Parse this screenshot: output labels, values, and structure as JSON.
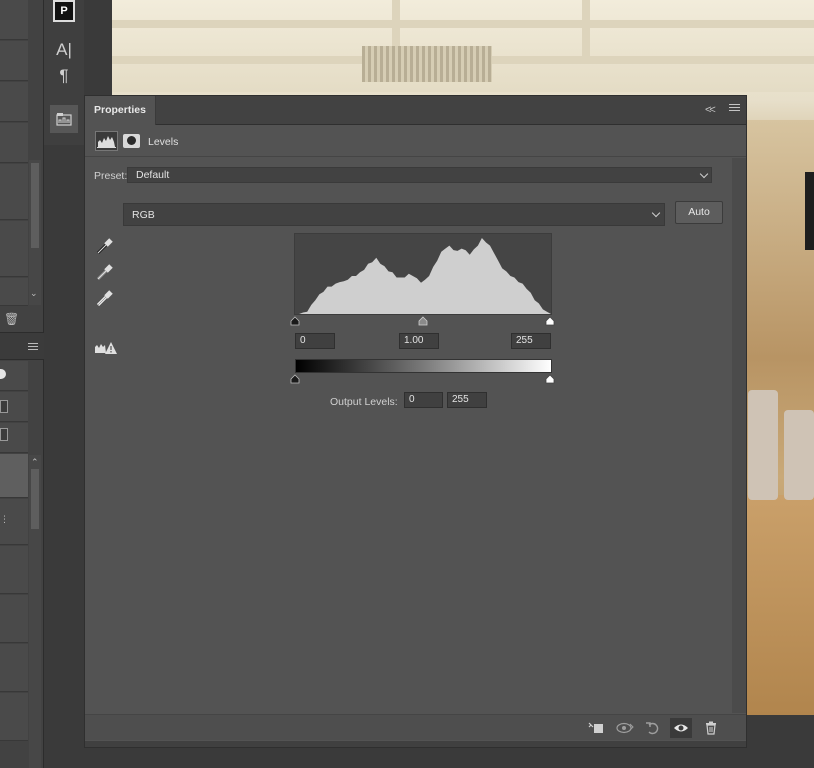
{
  "window": {
    "panel_tab": "Properties"
  },
  "adjustment": {
    "title": "Levels",
    "preset_label": "Preset:",
    "preset_value": "Default",
    "channel": "RGB",
    "auto_label": "Auto"
  },
  "input_levels": {
    "black": "0",
    "gamma": "1.00",
    "white": "255"
  },
  "output_levels": {
    "label": "Output Levels:",
    "black": "0",
    "white": "255"
  },
  "histogram": {
    "bins": [
      0,
      0,
      0.02,
      0.05,
      0.12,
      0.2,
      0.26,
      0.31,
      0.36,
      0.38,
      0.4,
      0.44,
      0.43,
      0.47,
      0.5,
      0.52,
      0.55,
      0.6,
      0.66,
      0.7,
      0.74,
      0.68,
      0.63,
      0.58,
      0.55,
      0.5,
      0.48,
      0.5,
      0.53,
      0.52,
      0.47,
      0.43,
      0.45,
      0.52,
      0.62,
      0.72,
      0.82,
      0.88,
      0.9,
      0.86,
      0.83,
      0.88,
      0.84,
      0.8,
      0.85,
      0.92,
      1.0,
      0.96,
      0.9,
      0.82,
      0.7,
      0.62,
      0.56,
      0.52,
      0.48,
      0.44,
      0.4,
      0.35,
      0.28,
      0.2,
      0.14,
      0.08,
      0.03,
      0.0
    ],
    "fill_color": "#cfcfcf"
  },
  "icons": {
    "histogram": "histogram-icon",
    "mask": "mask-icon",
    "droppers": [
      "black-point-eyedropper-icon",
      "gray-point-eyedropper-icon",
      "white-point-eyedropper-icon"
    ],
    "clipping": "clipping-warning-icon",
    "footer": [
      "clip-to-layer-icon",
      "view-previous-state-icon",
      "reset-icon",
      "visibility-eye-icon",
      "trash-icon"
    ]
  },
  "colors": {
    "panel_bg": "#535353",
    "tabbar_bg": "#424242",
    "field_bg": "#404040"
  }
}
